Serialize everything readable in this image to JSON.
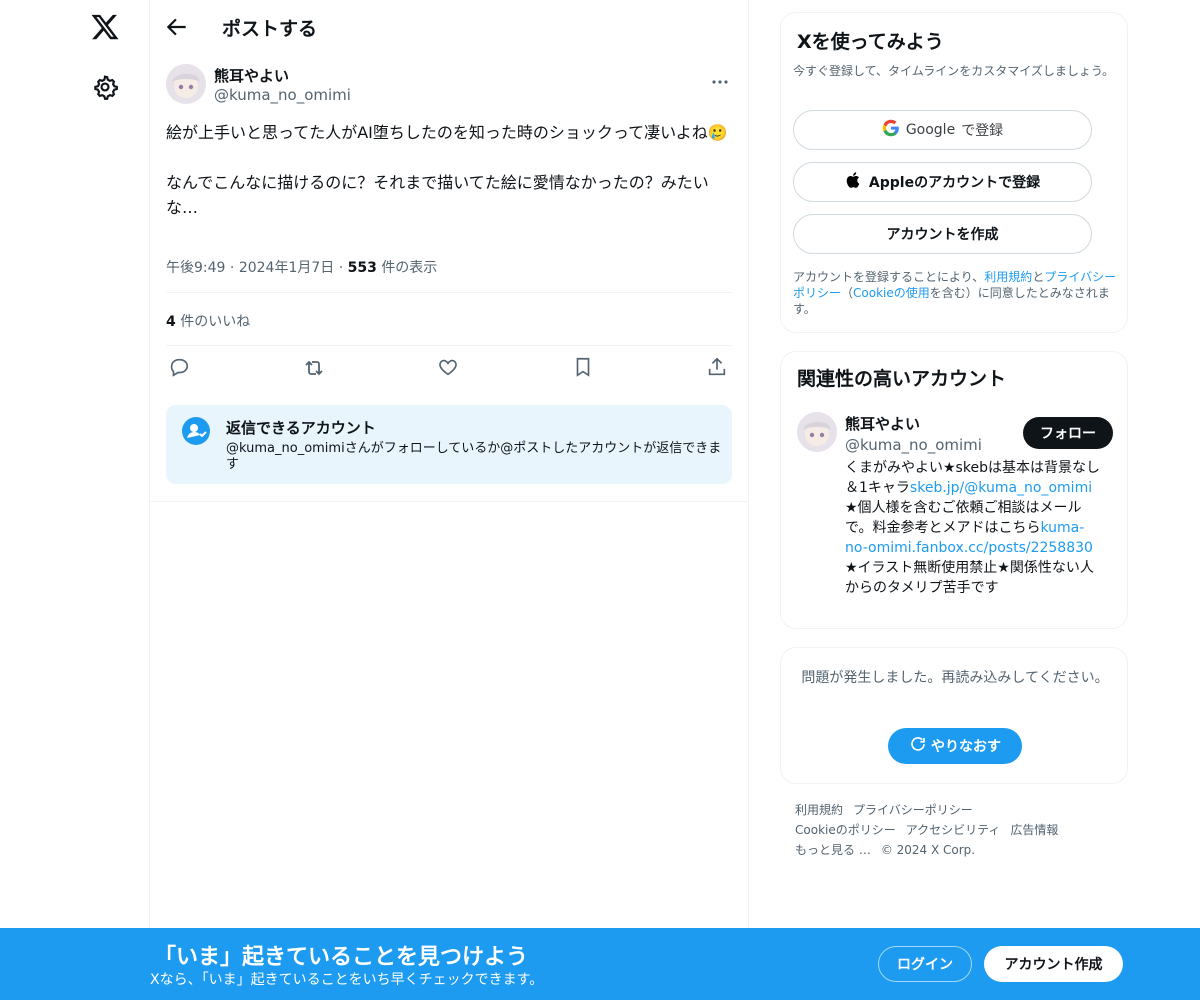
{
  "app": {
    "logo": "x-logo-icon",
    "settings_icon": "gear-icon"
  },
  "header": {
    "title": "ポストする",
    "back_icon": "arrow-left-icon"
  },
  "post": {
    "author_name": "熊耳やよい",
    "author_handle": "@kuma_no_omimi",
    "text": "絵が上手いと思ってた人がAI堕ちしたのを知った時のショックって凄いよね🥲\n\nなんでこんなに描けるのに？それまで描いてた絵に愛情なかったの？みたいな…",
    "time": "午後9:49",
    "date": "2024年1月7日",
    "views_count": "553",
    "views_label": "件の表示",
    "likes_count": "4",
    "likes_label": "件のいいね"
  },
  "reply_restriction": {
    "title": "返信できるアカウント",
    "description": "@kuma_no_omimiさんがフォローしているか@ポストしたアカウントが返信できます"
  },
  "signup": {
    "title": "Xを使ってみよう",
    "subtitle": "今すぐ登録して、タイムラインをカスタマイズしましょう。",
    "google_brand": "Google",
    "google_suffix": "で登録",
    "apple_label": "Appleのアカウントで登録",
    "create_label": "アカウントを作成",
    "legal_prefix": "アカウントを登録することにより、",
    "terms_link": "利用規約",
    "legal_and": "と",
    "privacy_link": "プライバシーポリシー",
    "legal_paren_open": "（",
    "cookie_link": "Cookieの使用",
    "legal_suffix": "を含む）に同意したとみなされます。"
  },
  "related": {
    "title": "関連性の高いアカウント",
    "name": "熊耳やよい",
    "handle": "@kuma_no_omimi",
    "follow_label": "フォロー",
    "bio_1": "くまがみやよい★skebは基本は背景なし＆1キャラ",
    "bio_link_1": "skeb.jp/@kuma_no_omimi",
    "bio_2": " ★個人様を含むご依頼ご相談はメールで。料金参考とメアドはこちら",
    "bio_link_2": "kuma-no-omimi.fanbox.cc/posts/2258830",
    "bio_3": " ★イラスト無断使用禁止★関係性ない人からのタメリプ苦手です"
  },
  "error": {
    "message": "問題が発生しました。再読み込みしてください。",
    "retry_label": "やりなおす"
  },
  "footer": {
    "links": [
      "利用規約",
      "プライバシーポリシー",
      "Cookieのポリシー",
      "アクセシビリティ",
      "広告情報",
      "もっと見る …"
    ],
    "copyright": "© 2024 X Corp."
  },
  "banner": {
    "title": "「いま」起きていることを見つけよう",
    "subtitle": "Xなら、「いま」起きていることをいち早くチェックできます。",
    "login_label": "ログイン",
    "create_label": "アカウント作成"
  },
  "colors": {
    "accent": "#1d9bf0",
    "text": "#0f1419",
    "muted": "#536471",
    "border": "#eff3f4"
  }
}
